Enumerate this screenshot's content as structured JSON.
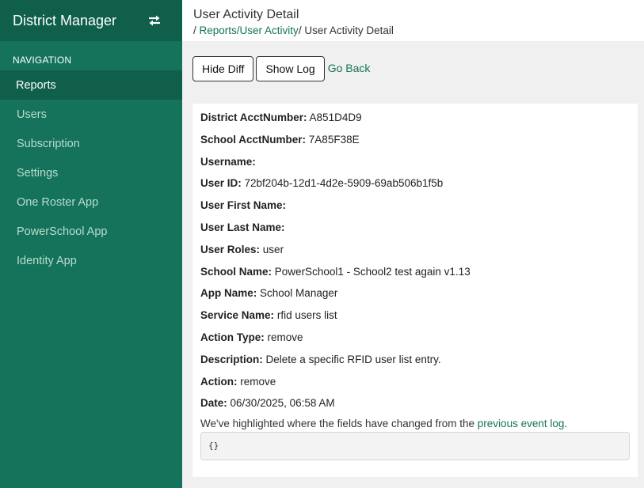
{
  "sidebar": {
    "brand": "District Manager",
    "nav_heading": "NAVIGATION",
    "items": [
      {
        "label": "Reports"
      },
      {
        "label": "Users"
      },
      {
        "label": "Subscription"
      },
      {
        "label": "Settings"
      },
      {
        "label": "One Roster App"
      },
      {
        "label": "PowerSchool App"
      },
      {
        "label": "Identity App"
      }
    ],
    "active_item": "Reports"
  },
  "header": {
    "title": "User Activity Detail",
    "breadcrumb": {
      "separator_start": "/ ",
      "link": "Reports/User Activity",
      "separator_end": "/ ",
      "current": "User Activity Detail"
    }
  },
  "actions": {
    "hide_diff": "Hide Diff",
    "show_log": "Show Log",
    "go_back": "Go Back"
  },
  "details": [
    {
      "label": "District AcctNumber:",
      "value": "A851D4D9"
    },
    {
      "label": "School AcctNumber:",
      "value": "7A85F38E"
    },
    {
      "label": "Username:",
      "value": ""
    },
    {
      "label": "User ID:",
      "value": "72bf204b-12d1-4d2e-5909-69ab506b1f5b"
    },
    {
      "label": "User First Name:",
      "value": ""
    },
    {
      "label": "User Last Name:",
      "value": ""
    },
    {
      "label": "User Roles:",
      "value": "user"
    },
    {
      "label": "School Name:",
      "value": "PowerSchool1 - School2 test again v1.13"
    },
    {
      "label": "App Name:",
      "value": "School Manager"
    },
    {
      "label": "Service Name:",
      "value": "rfid users list"
    },
    {
      "label": "Action Type:",
      "value": "remove"
    },
    {
      "label": "Description:",
      "value": "Delete a specific RFID user list entry."
    },
    {
      "label": "Action:",
      "value": "remove"
    },
    {
      "label": "Date:",
      "value": "06/30/2025, 06:58 AM"
    }
  ],
  "diff_note": {
    "text": "We've highlighted where the fields have changed from the ",
    "link": "previous event log",
    "end": "."
  },
  "diff_content": "{}",
  "colors": {
    "sidebar": "#14735a",
    "sidebar_dark": "#0f5f4b",
    "link": "#14735a"
  }
}
